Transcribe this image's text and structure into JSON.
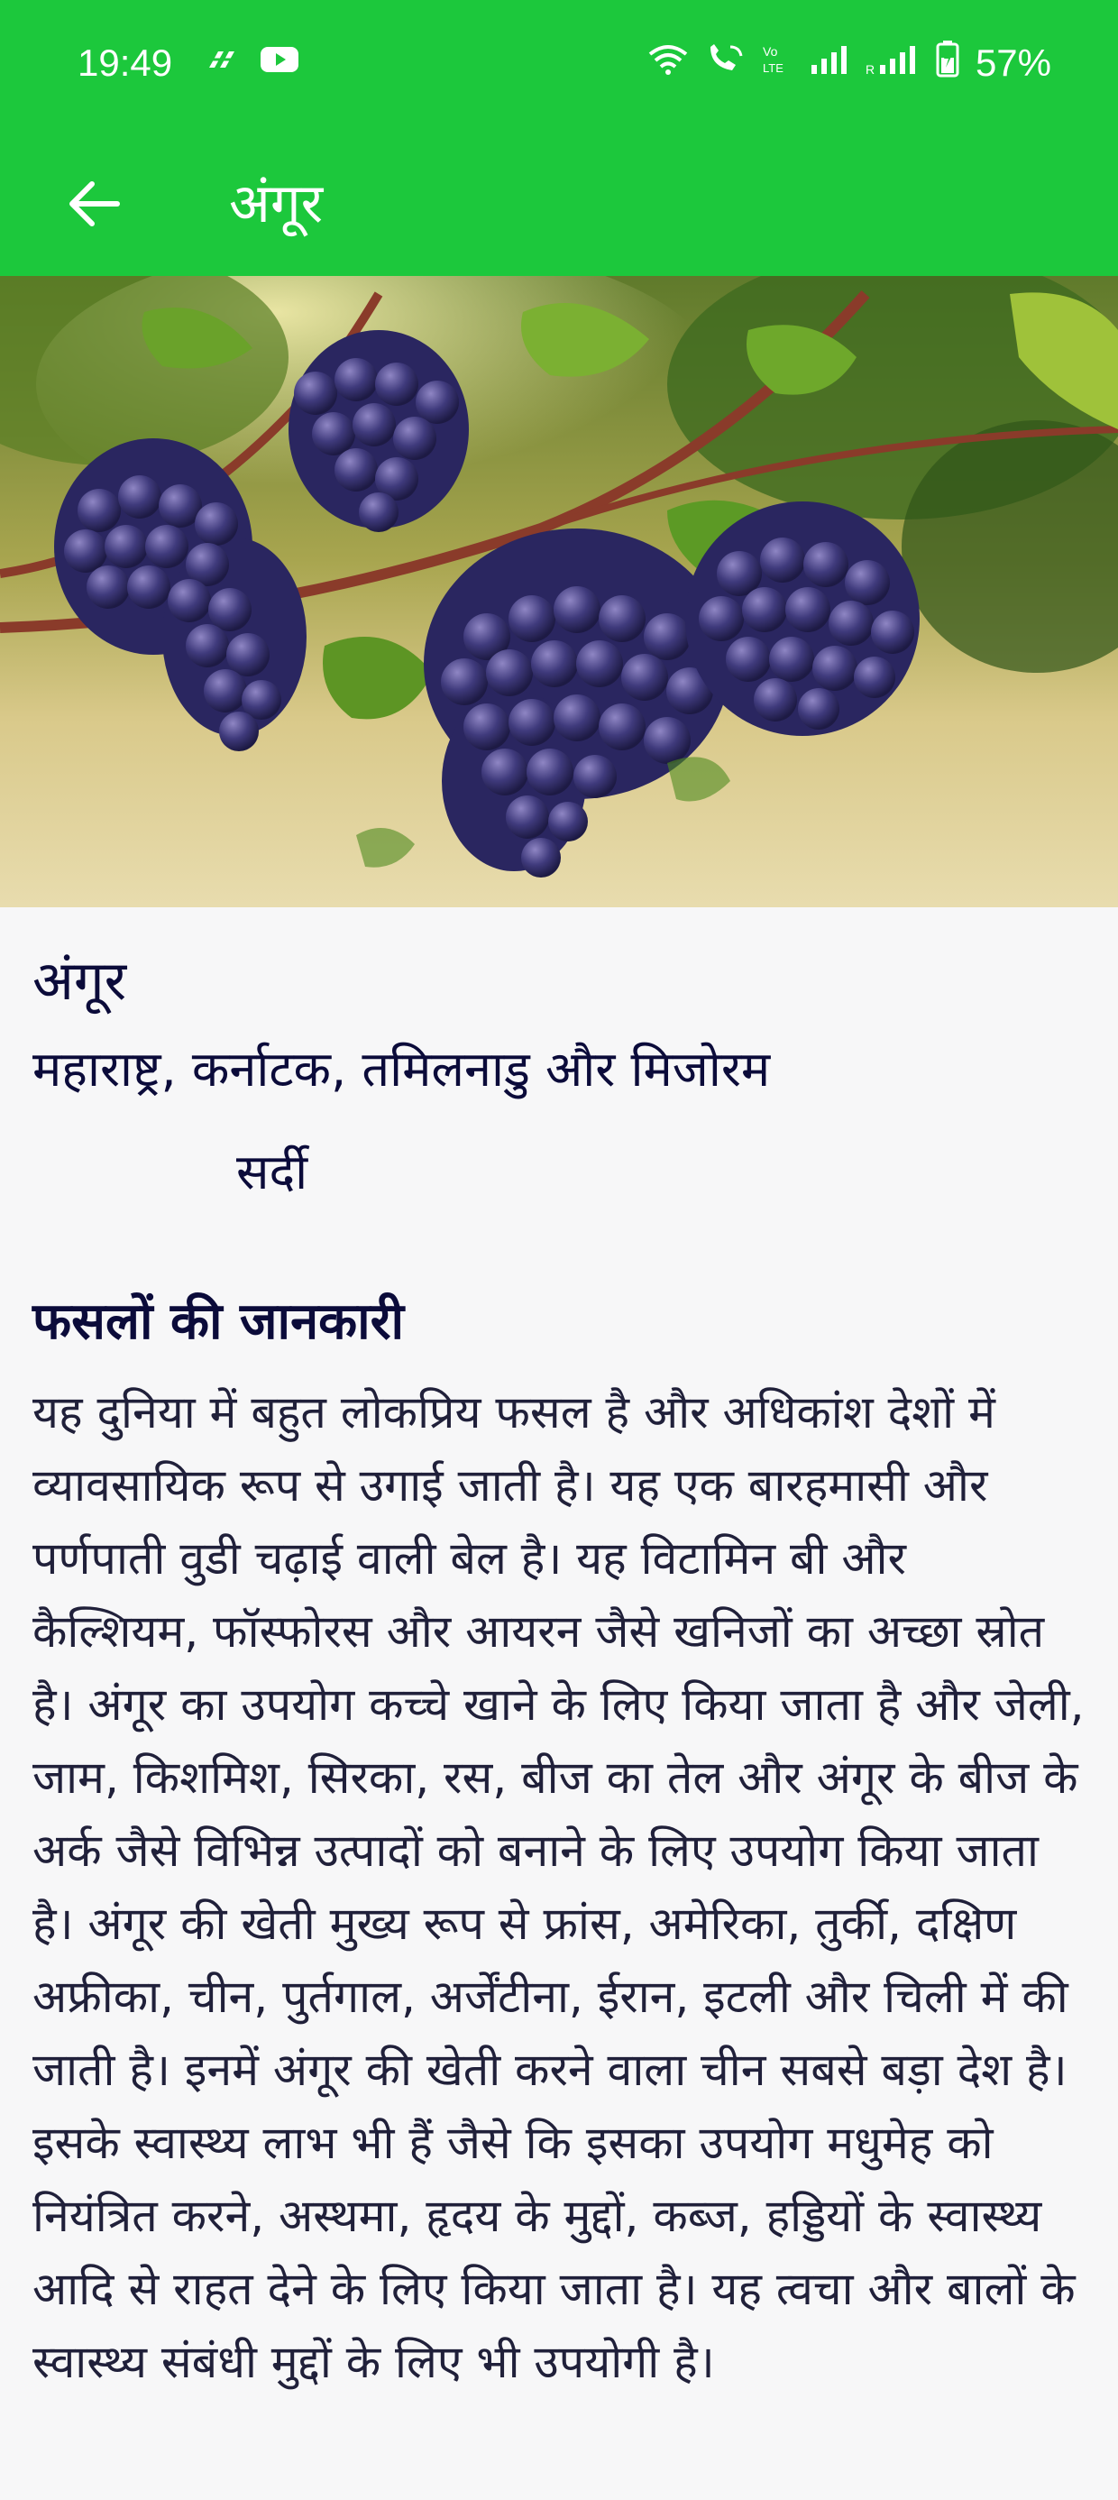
{
  "status_bar": {
    "time": "19:49",
    "battery": "57%",
    "left_icons": [
      "app-notification-icon",
      "youtube-icon"
    ],
    "right_icons": [
      "wifi-icon",
      "wifi-calling-icon",
      "volte-icon",
      "signal-icon",
      "roaming-signal-icon",
      "battery-icon"
    ]
  },
  "app_bar": {
    "title": "अंगूर",
    "back_icon": "arrow-left-icon"
  },
  "hero_image": {
    "subject": "grapes"
  },
  "crop": {
    "name": "अंगूर",
    "regions": "महाराष्ट्र, कर्नाटक, तमिलनाडु और मिजोरम",
    "season": "सर्दी",
    "section_title": "फसलों की जानकारी",
    "description": "यह दुनिया में बहुत लोकप्रिय फसल है और अधिकांश देशों में व्यावसायिक रूप से उगाई जाती है। यह एक बारहमासी और पर्णपाती वुडी चढ़ाई वाली बेल है। यह विटामिन बी और कैल्शियम, फॉस्फोरस और आयरन जैसे खनिजों का अच्छा स्रोत है। अंगूर का उपयोग कच्चे खाने के लिए किया जाता है और जेली, जाम, किशमिश, सिरका, रस, बीज का तेल और अंगूर के बीज के अर्क जैसे विभिन्न उत्पादों को बनाने के लिए उपयोग किया जाता है। अंगूर की खेती मुख्य रूप से फ्रांस, अमेरिका, तुर्की, दक्षिण अफ्रीका, चीन, पुर्तगाल, अर्जेंटीना, ईरान, इटली और चिली में की जाती है। इनमें अंगूर की खेती करने वाला चीन सबसे बड़ा देश है। इसके स्वास्थ्य लाभ भी हैं जैसे कि इसका उपयोग मधुमेह को नियंत्रित करने, अस्थमा, हृदय के मुद्दों, कब्ज, हड्डियों के स्वास्थ्य आदि से राहत देने के लिए किया जाता है। यह त्वचा और बालों के स्वास्थ्य संबंधी मुद्दों के लिए भी उपयोगी है।"
  },
  "colors": {
    "primary": "#1cc83c",
    "text_dark": "#0b0b3a",
    "background": "#f7f7f8"
  }
}
